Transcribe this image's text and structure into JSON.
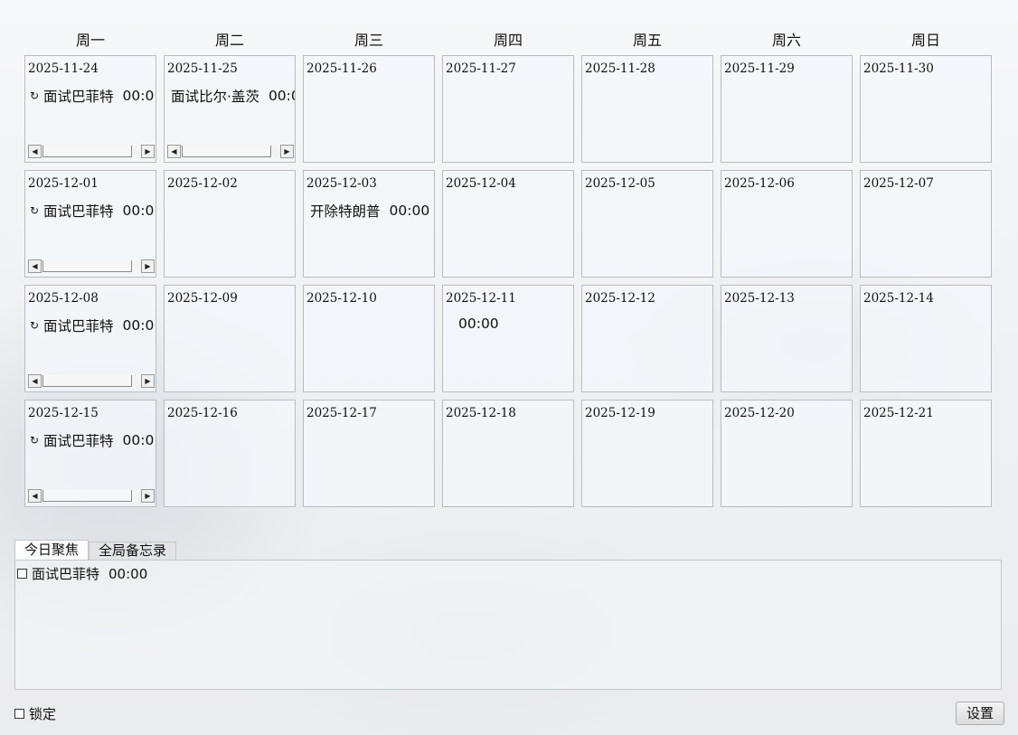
{
  "weekdays": [
    "周一",
    "周二",
    "周三",
    "周四",
    "周五",
    "周六",
    "周日"
  ],
  "weeks": [
    {
      "days": [
        {
          "date": "2025-11-24",
          "event": {
            "repeat": true,
            "title": "面试巴菲特",
            "time": "00:0"
          },
          "scroll": true
        },
        {
          "date": "2025-11-25",
          "event": {
            "repeat": false,
            "title": "面试比尔·盖茨",
            "time": "00:0"
          },
          "scroll": true
        },
        {
          "date": "2025-11-26"
        },
        {
          "date": "2025-11-27"
        },
        {
          "date": "2025-11-28"
        },
        {
          "date": "2025-11-29"
        },
        {
          "date": "2025-11-30"
        }
      ]
    },
    {
      "days": [
        {
          "date": "2025-12-01",
          "event": {
            "repeat": true,
            "title": "面试巴菲特",
            "time": "00:0"
          },
          "scroll": true
        },
        {
          "date": "2025-12-02"
        },
        {
          "date": "2025-12-03",
          "event": {
            "repeat": false,
            "title": "开除特朗普",
            "time": "00:00"
          }
        },
        {
          "date": "2025-12-04"
        },
        {
          "date": "2025-12-05"
        },
        {
          "date": "2025-12-06"
        },
        {
          "date": "2025-12-07"
        }
      ]
    },
    {
      "days": [
        {
          "date": "2025-12-08",
          "event": {
            "repeat": true,
            "title": "面试巴菲特",
            "time": "00:0"
          },
          "scroll": true
        },
        {
          "date": "2025-12-09"
        },
        {
          "date": "2025-12-10"
        },
        {
          "date": "2025-12-11",
          "event": {
            "repeat": false,
            "title": "",
            "time": "00:00"
          }
        },
        {
          "date": "2025-12-12"
        },
        {
          "date": "2025-12-13"
        },
        {
          "date": "2025-12-14"
        }
      ]
    },
    {
      "days": [
        {
          "date": "2025-12-15",
          "event": {
            "repeat": true,
            "title": "面试巴菲特",
            "time": "00:0"
          },
          "scroll": true
        },
        {
          "date": "2025-12-16"
        },
        {
          "date": "2025-12-17"
        },
        {
          "date": "2025-12-18"
        },
        {
          "date": "2025-12-19"
        },
        {
          "date": "2025-12-20"
        },
        {
          "date": "2025-12-21"
        }
      ]
    }
  ],
  "tabs": [
    "今日聚焦",
    "全局备忘录"
  ],
  "today_tasks": [
    {
      "title": "面试巴菲特",
      "time": "00:00",
      "checked": false
    }
  ],
  "lock_label": "锁定",
  "settings_label": "设置",
  "icons": {
    "repeat": "repeat-icon",
    "scroll_left": "scroll-left-arrow-icon",
    "scroll_right": "scroll-right-arrow-icon"
  }
}
